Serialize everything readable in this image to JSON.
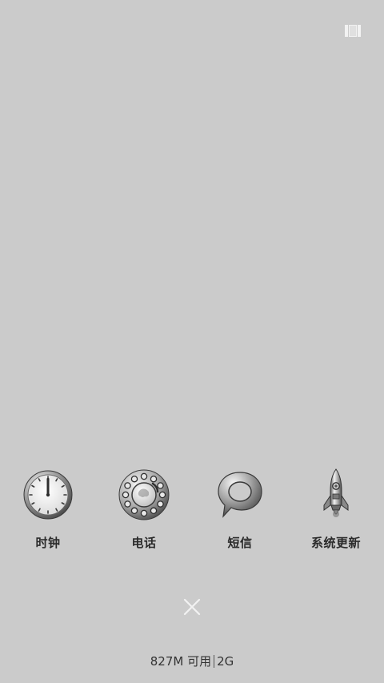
{
  "top_bar": {
    "view_toggle_icon": "view-toggle-icon"
  },
  "apps": [
    {
      "label": "时钟",
      "icon": "clock-icon"
    },
    {
      "label": "电话",
      "icon": "rotary-phone-icon"
    },
    {
      "label": "短信",
      "icon": "speech-bubble-icon"
    },
    {
      "label": "系统更新",
      "icon": "rocket-icon"
    }
  ],
  "close_icon": "close-icon",
  "status": {
    "available_memory": "827M 可用",
    "total_memory": "2G"
  },
  "colors": {
    "background": "#cbcbcb",
    "label_text": "#2a2a2a",
    "icon_metal": "#9a9a9a"
  }
}
